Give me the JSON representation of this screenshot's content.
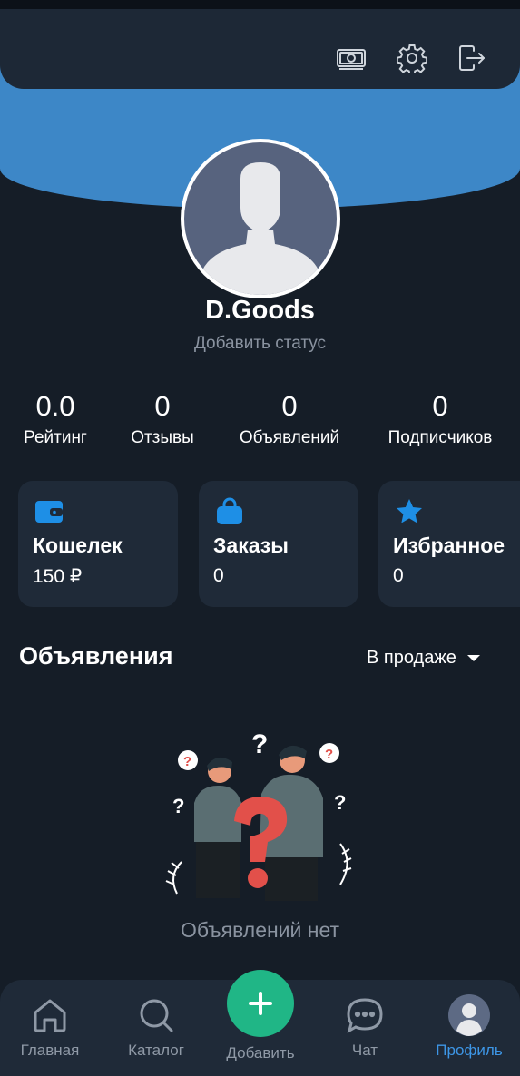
{
  "header": {
    "icons": [
      "money-icon",
      "settings-icon",
      "logout-icon"
    ]
  },
  "profile": {
    "name": "D.Goods",
    "status_placeholder": "Добавить статус"
  },
  "stats": [
    {
      "value": "0.0",
      "label": "Рейтинг"
    },
    {
      "value": "0",
      "label": "Отзывы"
    },
    {
      "value": "0",
      "label": "Объявлений"
    },
    {
      "value": "0",
      "label": "Подписчиков"
    }
  ],
  "cards": [
    {
      "icon": "wallet-icon",
      "title": "Кошелек",
      "value": "150 ₽"
    },
    {
      "icon": "bag-icon",
      "title": "Заказы",
      "value": "0"
    },
    {
      "icon": "star-icon",
      "title": "Избранное",
      "value": "0"
    }
  ],
  "listings": {
    "title": "Объявления",
    "filter": "В продаже",
    "empty_text": "Объявлений нет"
  },
  "nav": {
    "home": "Главная",
    "catalog": "Каталог",
    "add": "Добавить",
    "chat": "Чат",
    "profile": "Профиль"
  },
  "colors": {
    "background": "#151d27",
    "accent_blue": "#3d87c7",
    "accent_green": "#20b686",
    "active_nav": "#3d96e6"
  }
}
